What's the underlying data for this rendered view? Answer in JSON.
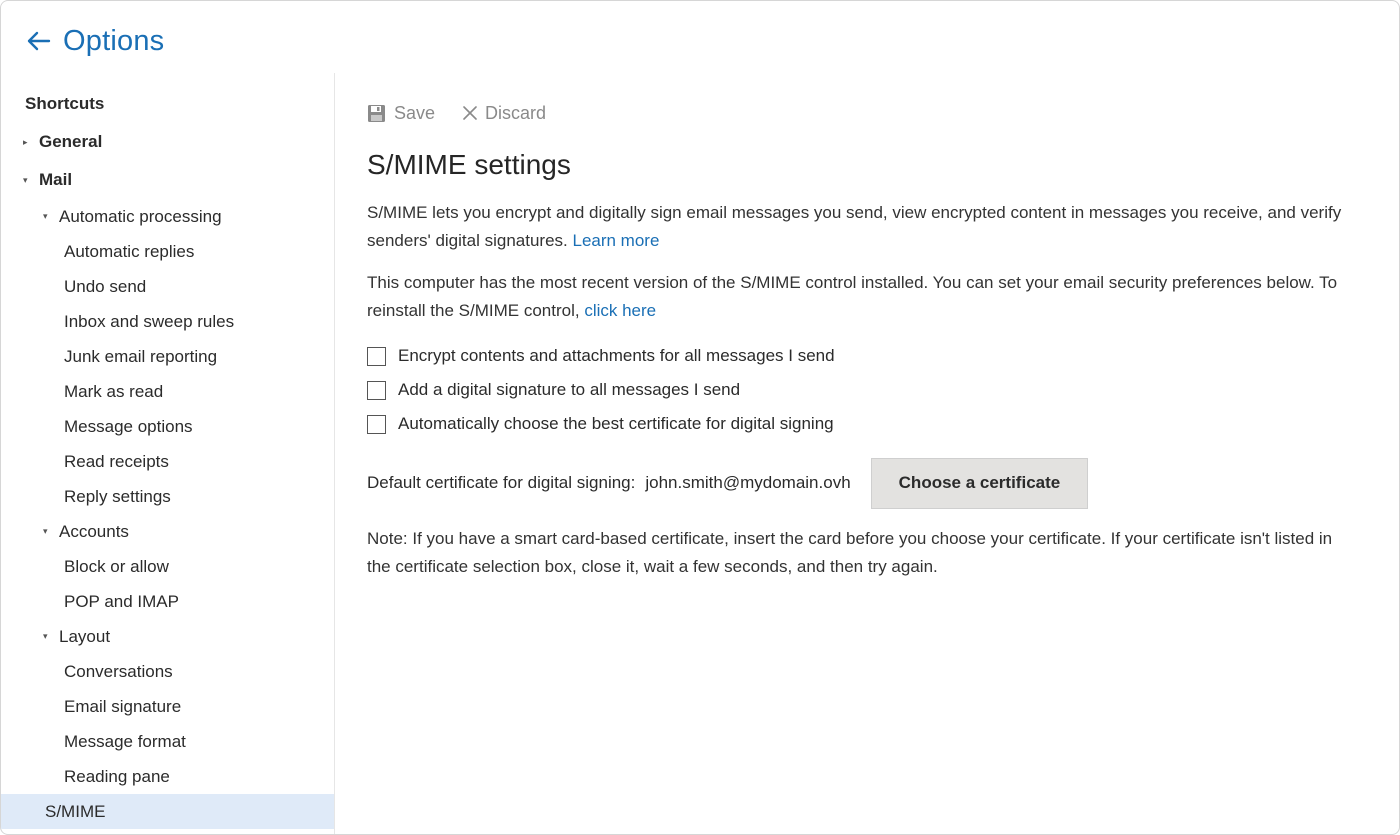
{
  "header": {
    "title": "Options"
  },
  "sidebar": {
    "items": [
      {
        "label": "Shortcuts"
      },
      {
        "label": "General"
      },
      {
        "label": "Mail"
      },
      {
        "label": "Automatic processing"
      },
      {
        "label": "Automatic replies"
      },
      {
        "label": "Undo send"
      },
      {
        "label": "Inbox and sweep rules"
      },
      {
        "label": "Junk email reporting"
      },
      {
        "label": "Mark as read"
      },
      {
        "label": "Message options"
      },
      {
        "label": "Read receipts"
      },
      {
        "label": "Reply settings"
      },
      {
        "label": "Accounts"
      },
      {
        "label": "Block or allow"
      },
      {
        "label": "POP and IMAP"
      },
      {
        "label": "Layout"
      },
      {
        "label": "Conversations"
      },
      {
        "label": "Email signature"
      },
      {
        "label": "Message format"
      },
      {
        "label": "Reading pane"
      },
      {
        "label": "S/MIME"
      }
    ],
    "selected": "S/MIME"
  },
  "toolbar": {
    "save_label": "Save",
    "discard_label": "Discard"
  },
  "main": {
    "title": "S/MIME settings",
    "intro_text": "S/MIME lets you encrypt and digitally sign email messages you send, view encrypted content in messages you receive, and verify senders' digital signatures.",
    "learn_more": "Learn more",
    "control_text": "This computer has the most recent version of the S/MIME control installed. You can set your email security preferences below. To reinstall the S/MIME control,",
    "click_here": "click here",
    "options": [
      {
        "label": "Encrypt contents and attachments for all messages I send",
        "checked": false
      },
      {
        "label": "Add a digital signature to all messages I send",
        "checked": false
      },
      {
        "label": "Automatically choose the best certificate for digital signing",
        "checked": false
      }
    ],
    "cert_label": "Default certificate for digital signing:",
    "cert_value": "john.smith@mydomain.ovh",
    "cert_button": "Choose a certificate",
    "note": "Note: If you have a smart card-based certificate, insert the card before you choose your certificate. If your certificate isn't listed in the certificate selection box, close it, wait a few seconds, and then try again."
  },
  "colors": {
    "accent": "#1a6fb5",
    "selected_bg": "#dfeaf8",
    "button_bg": "#e3e2e0"
  }
}
